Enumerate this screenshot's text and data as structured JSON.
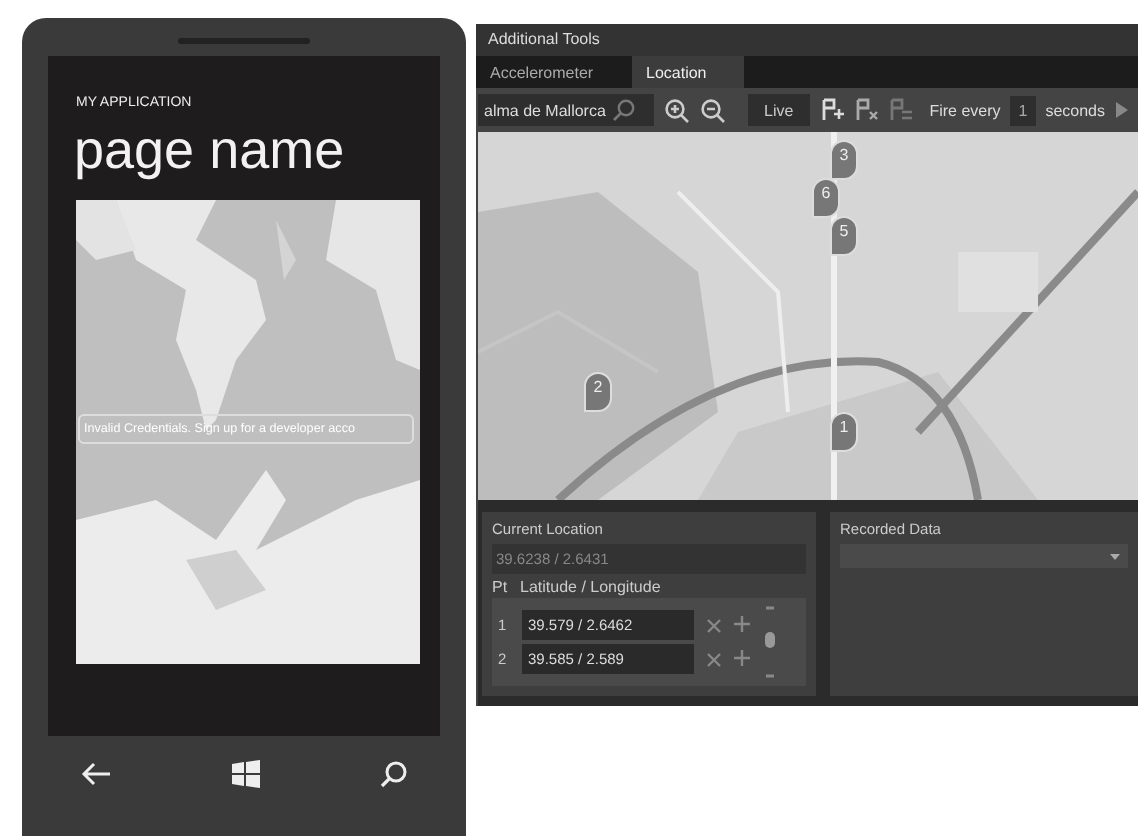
{
  "phone": {
    "app_title": "MY APPLICATION",
    "page_title": "page name",
    "map": {
      "banner": "Invalid Credentials. Sign up for a developer acco"
    }
  },
  "tools": {
    "title": "Additional Tools",
    "tabs": [
      {
        "label": "Accelerometer",
        "selected": false
      },
      {
        "label": "Location",
        "selected": true
      }
    ],
    "toolbar": {
      "search": "alma de Mallorca",
      "live": "Live",
      "fire_every": "Fire every",
      "interval": "1",
      "unit": "seconds"
    },
    "map": {
      "pins": [
        {
          "label": "3"
        },
        {
          "label": "6"
        },
        {
          "label": "5"
        },
        {
          "label": "2"
        },
        {
          "label": "1"
        }
      ]
    },
    "current_location": {
      "title": "Current Location",
      "value": "39.6238 / 2.6431",
      "columns": [
        "Pt",
        "Latitude / Longitude"
      ],
      "points": [
        {
          "pt": "1",
          "value": "39.579 / 2.6462"
        },
        {
          "pt": "2",
          "value": "39.585 / 2.589"
        }
      ]
    },
    "recorded_data": {
      "title": "Recorded Data"
    }
  }
}
